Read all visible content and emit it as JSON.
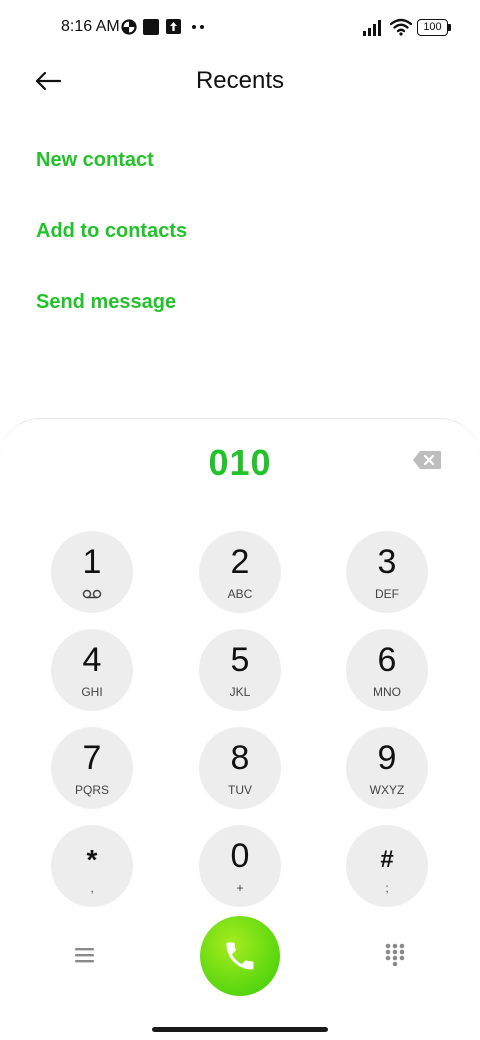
{
  "status_bar": {
    "time": "8:16 AM",
    "battery": "100",
    "icons": [
      "data-saver-icon",
      "square-notification-icon",
      "upload-notification-icon",
      "more-notifications-icon",
      "signal-icon",
      "wifi-icon",
      "battery-icon"
    ]
  },
  "header": {
    "title": "Recents",
    "back_icon": "arrow-left-icon"
  },
  "actions": [
    {
      "label": "New contact"
    },
    {
      "label": "Add to contacts"
    },
    {
      "label": "Send message"
    }
  ],
  "dialer": {
    "number": "010",
    "backspace_icon": "backspace-icon",
    "keys": [
      {
        "digit": "1",
        "sub": "",
        "sub_icon": "voicemail-icon"
      },
      {
        "digit": "2",
        "sub": "ABC"
      },
      {
        "digit": "3",
        "sub": "DEF"
      },
      {
        "digit": "4",
        "sub": "GHI"
      },
      {
        "digit": "5",
        "sub": "JKL"
      },
      {
        "digit": "6",
        "sub": "MNO"
      },
      {
        "digit": "7",
        "sub": "PQRS"
      },
      {
        "digit": "8",
        "sub": "TUV"
      },
      {
        "digit": "9",
        "sub": "WXYZ"
      },
      {
        "digit": "*",
        "sub": ","
      },
      {
        "digit": "0",
        "sub": "+"
      },
      {
        "digit": "#",
        "sub": ";"
      }
    ],
    "bottom_icons": [
      "menu-icon",
      "phone-icon",
      "dialpad-icon"
    ]
  },
  "colors": {
    "accent": "#22c32a",
    "key_background": "#ededed",
    "call_button": "#58d60f"
  }
}
